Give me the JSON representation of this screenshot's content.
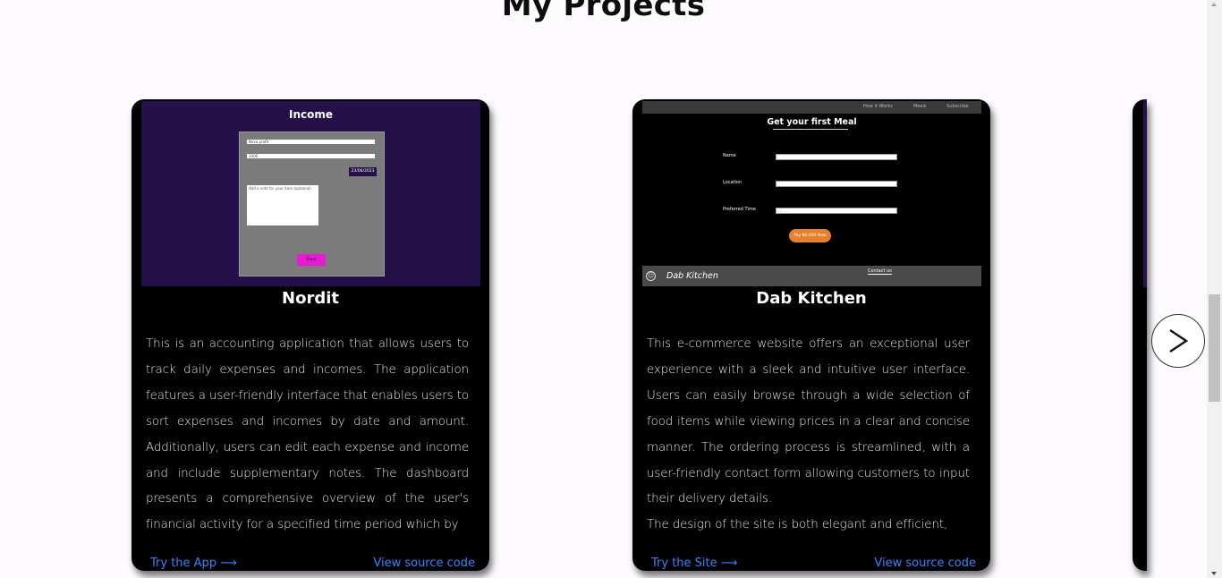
{
  "page": {
    "title": "My Projects"
  },
  "projects": [
    {
      "name": "Nordit",
      "description": "This is an accounting application that allows users to track daily expenses and incomes. The application features a user-friendly interface that enables users to sort expenses and incomes by date and amount. Additionally, users can edit each expense and income and include supplementary notes. The dashboard presents a comprehensive overview of the user's financial activity for a specified time period which by",
      "try_label": "Try the App ⟶",
      "source_label": "View source code",
      "screenshot": {
        "title": "Income",
        "field1": "Nova profit",
        "field2": "1000",
        "date": "23/06/2023",
        "notes_placeholder": "Add a note for your item (optional)",
        "save": "Save"
      }
    },
    {
      "name": "Dab Kitchen",
      "description_1": "This e-commerce website offers an exceptional user experience with a sleek and intuitive user interface. Users can easily browse through a wide selection of food items while viewing prices in a clear and concise manner. The ordering process is streamlined, with a user-friendly contact form allowing customers to input their delivery details.",
      "description_2": "The design of the site is both elegant and efficient,",
      "try_label": "Try the Site ⟶",
      "source_label": "View source code",
      "screenshot": {
        "nav": [
          "How it Works",
          "Meals",
          "Subscribe"
        ],
        "title": "Get your first Meal",
        "label_name": "Name",
        "label_location": "Location",
        "label_time": "Preferred Time",
        "time_placeholder": "--:-- --",
        "button": "Pay ₦4,000 Now",
        "brand": "Dab Kitchen",
        "contact": "Contact us"
      }
    }
  ],
  "icons": {
    "next": "chevron-right-icon",
    "logo": "dab-logo-icon"
  },
  "colors": {
    "link": "#2f86ff",
    "card_bg": "#000000",
    "nordit_bg": "#25114a",
    "save_btn": "#e81ad4",
    "pay_btn": "#e8802a"
  }
}
